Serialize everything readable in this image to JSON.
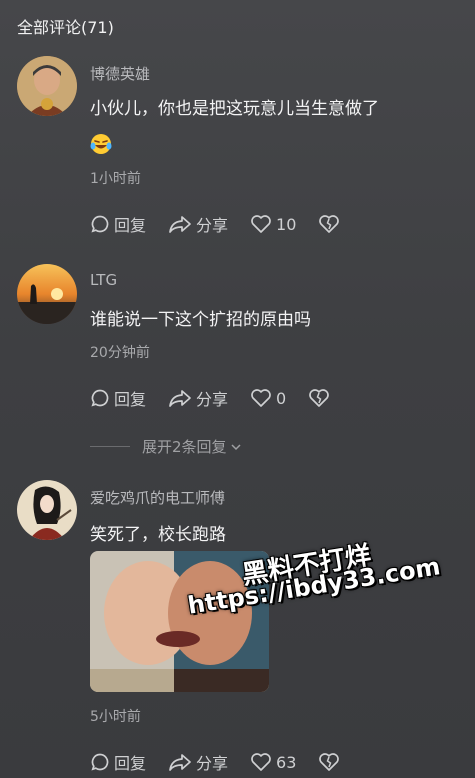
{
  "header": {
    "title": "全部评论(71)"
  },
  "comments": [
    {
      "author": "博德英雄",
      "text": "小伙儿，你也是把这玩意儿当生意做了",
      "emoji": "laughing-tears-emoji",
      "time": "1小时前",
      "reply_label": "回复",
      "share_label": "分享",
      "likes": "10"
    },
    {
      "author": "LTG",
      "text": "谁能说一下这个扩招的原由吗",
      "time": "20分钟前",
      "reply_label": "回复",
      "share_label": "分享",
      "likes": "0"
    },
    {
      "author": "爱吃鸡爪的电工师傅",
      "text": "笑死了，校长跑路",
      "time": "5小时前",
      "reply_label": "回复",
      "share_label": "分享",
      "likes": "63"
    }
  ],
  "expand_replies": {
    "label": "展开2条回复"
  },
  "watermark": {
    "line1": "黑料不打烊",
    "line2": "https://ibdy33.com"
  },
  "icons": {
    "reply": "comment-bubble-icon",
    "share": "share-arrow-icon",
    "like": "heart-icon",
    "dislike": "broken-heart-icon",
    "expand": "chevron-down-icon"
  },
  "colors": {
    "background": "#414245",
    "text": "#f3f3f4",
    "meta": "#a8a9ac"
  }
}
